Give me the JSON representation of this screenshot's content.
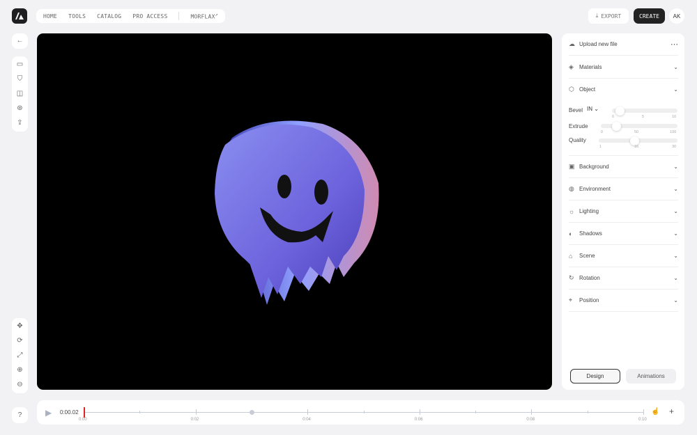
{
  "nav": {
    "items": [
      "HOME",
      "TOOLS",
      "CATALOG",
      "PRO ACCESS"
    ],
    "external": "MORFLAX",
    "external_icon": "arrow-up-right-icon"
  },
  "header": {
    "export_label": "EXPORT",
    "create_label": "CREATE",
    "avatar": "AK"
  },
  "panel": {
    "upload_label": "Upload new file",
    "more_icon": "more-icon",
    "sections_top": [
      {
        "label": "Materials",
        "icon": "materials-icon"
      },
      {
        "label": "Object",
        "icon": "cube-icon"
      }
    ],
    "bevel": {
      "label": "Bevel",
      "mode": "IN",
      "ticks": [
        "0",
        "5",
        "10"
      ],
      "value": 1
    },
    "extrude": {
      "label": "Extrude",
      "ticks": [
        "0",
        "50",
        "100"
      ],
      "value": 20
    },
    "quality": {
      "label": "Quality",
      "ticks": [
        "1",
        "16",
        "30"
      ],
      "value": 16
    },
    "sections": [
      {
        "label": "Background",
        "icon": "image-icon"
      },
      {
        "label": "Environment",
        "icon": "globe-icon"
      },
      {
        "label": "Lighting",
        "icon": "sun-icon"
      },
      {
        "label": "Shadows",
        "icon": "shadow-icon"
      },
      {
        "label": "Scene",
        "icon": "scene-icon"
      },
      {
        "label": "Rotation",
        "icon": "rotation-icon"
      },
      {
        "label": "Position",
        "icon": "position-icon"
      }
    ],
    "tab_design": "Design",
    "tab_animations": "Animations"
  },
  "timeline": {
    "current_time": "0:00.02",
    "labels": [
      "0:00",
      "0:02",
      "0:04",
      "0:06",
      "0:08",
      "0:10"
    ],
    "playhead_color": "#e02424"
  },
  "help": "?"
}
